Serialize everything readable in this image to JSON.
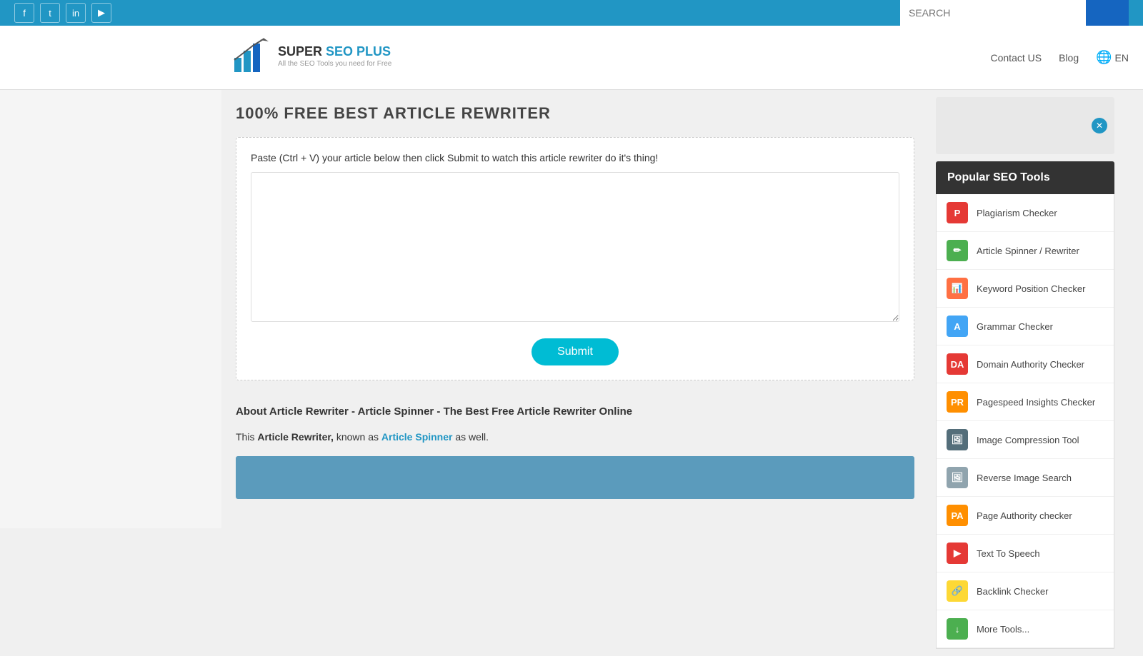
{
  "topbar": {
    "social": [
      "f",
      "t",
      "in",
      "▶"
    ],
    "search_placeholder": "SEARCH",
    "search_btn": ""
  },
  "header": {
    "logo_super": "SUPER",
    "logo_seo": " SEO PLUS",
    "logo_sub": "All the SEO Tools you need for Free",
    "nav": {
      "contact": "Contact US",
      "blog": "Blog",
      "lang": "EN"
    }
  },
  "main": {
    "title": "100% FREE BEST ARTICLE REWRITER",
    "instruction": "Paste (Ctrl + V) your article below then click Submit to watch this article rewriter do it's thing!",
    "textarea_placeholder": "",
    "submit_label": "Submit",
    "about_title": "About Article Rewriter - Article Spinner - The Best Free Article Rewriter Online",
    "about_text_1": "This ",
    "about_bold_1": "Article Rewriter,",
    "about_link": " known as ",
    "about_bold_2": "Article Spinner",
    "about_text_2": " as well."
  },
  "sidebar": {
    "popular_title": "Popular SEO Tools",
    "tools": [
      {
        "name": "Plagiarism Checker",
        "icon_label": "P",
        "color": "#e53935"
      },
      {
        "name": "Article Spinner / Rewriter",
        "icon_label": "✏",
        "color": "#4caf50"
      },
      {
        "name": "Keyword Position Checker",
        "icon_label": "📊",
        "color": "#ff7043"
      },
      {
        "name": "Grammar Checker",
        "icon_label": "A",
        "color": "#42a5f5"
      },
      {
        "name": "Domain Authority Checker",
        "icon_label": "DA",
        "color": "#e53935"
      },
      {
        "name": "Pagespeed Insights Checker",
        "icon_label": "PR",
        "color": "#ff8f00"
      },
      {
        "name": "Image Compression Tool",
        "icon_label": "🖼",
        "color": "#546e7a"
      },
      {
        "name": "Reverse Image Search",
        "icon_label": "🖼",
        "color": "#90a4ae"
      },
      {
        "name": "Page Authority checker",
        "icon_label": "PA",
        "color": "#ff8f00"
      },
      {
        "name": "Text To Speech",
        "icon_label": "▶",
        "color": "#e53935"
      },
      {
        "name": "Backlink Checker",
        "icon_label": "🔗",
        "color": "#fdd835"
      },
      {
        "name": "More Tools...",
        "icon_label": "↓",
        "color": "#4caf50"
      }
    ]
  }
}
